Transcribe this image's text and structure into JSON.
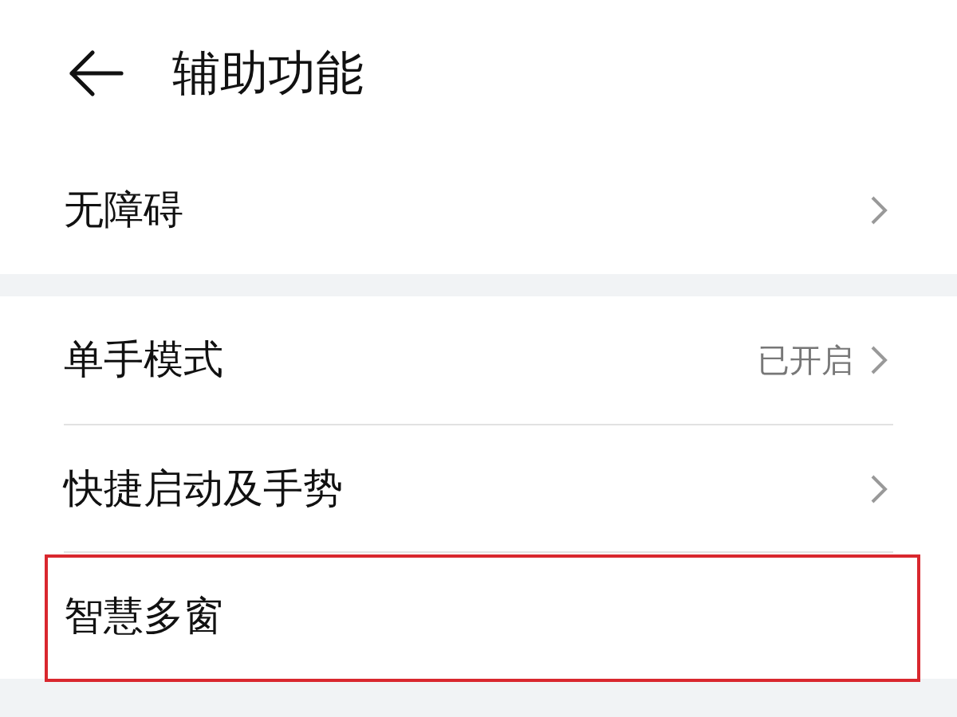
{
  "header": {
    "title": "辅助功能"
  },
  "groups": [
    {
      "items": [
        {
          "label": "无障碍",
          "has_arrow": true,
          "highlighted": false
        }
      ]
    },
    {
      "items": [
        {
          "label": "单手模式",
          "value": "已开启",
          "has_arrow": true,
          "highlighted": false
        },
        {
          "label": "快捷启动及手势",
          "has_arrow": true,
          "highlighted": false
        },
        {
          "label": "智慧多窗",
          "has_arrow": false,
          "highlighted": true
        }
      ]
    }
  ]
}
